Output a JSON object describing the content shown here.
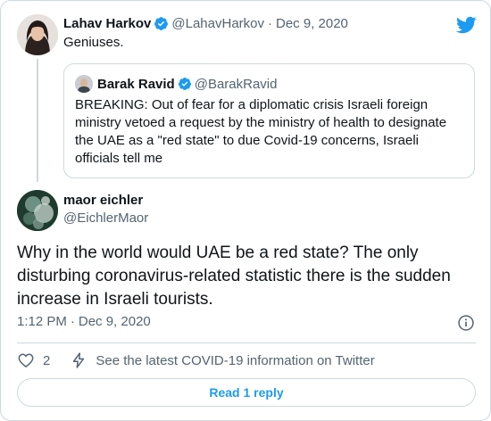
{
  "colors": {
    "accent": "#1d9bf0",
    "text_primary": "#0f1419",
    "text_secondary": "#536471",
    "border": "#cfd9de"
  },
  "parent_tweet": {
    "author_name": "Lahav Harkov",
    "author_handle": "@LahavHarkov",
    "separator": "·",
    "date": "Dec 9, 2020",
    "text": "Geniuses.",
    "avatar_icon": "person-avatar",
    "quoted_tweet": {
      "author_name": "Barak Ravid",
      "author_handle": "@BarakRavid",
      "avatar_icon": "person-avatar",
      "text": "BREAKING: Out of fear for a diplomatic crisis Israeli foreign ministry vetoed a request by the ministry of health to designate the UAE as a \"red state\" to due Covid-19 concerns, Israeli officials tell me"
    }
  },
  "logo_icon": "twitter-bird-icon",
  "main_tweet": {
    "author_name": "maor eichler",
    "author_handle": "@EichlerMaor",
    "avatar_icon": "person-avatar",
    "text": "Why in the world would UAE be a red state? The only disturbing coronavirus-related statistic there is the sudden increase in Israeli tourists.",
    "time": "1:12 PM",
    "separator": "·",
    "date": "Dec 9, 2020"
  },
  "actions": {
    "like_count": "2",
    "covid_info_label": "See the latest COVID-19 information on Twitter",
    "read_reply_label": "Read 1 reply"
  }
}
